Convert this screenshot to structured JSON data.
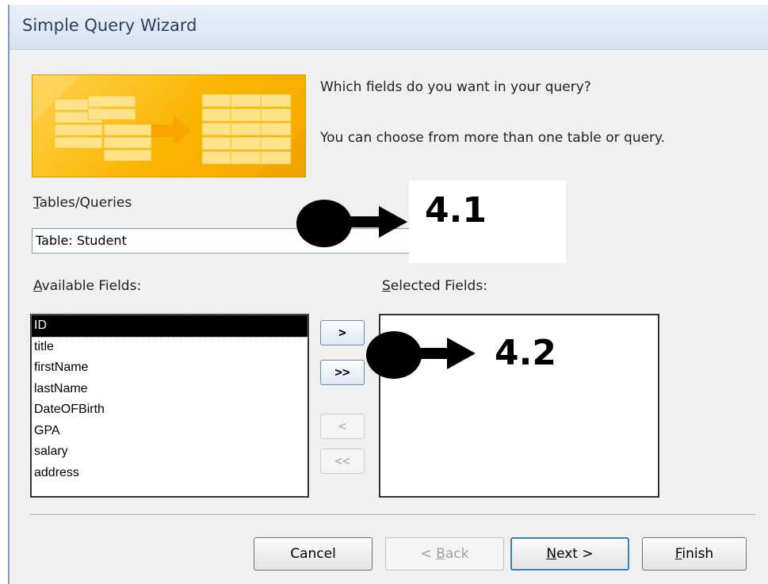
{
  "window": {
    "title": "Simple Query Wizard"
  },
  "intro": {
    "question": "Which fields do you want in your query?",
    "hint": "You can choose from more than one table or query."
  },
  "tables_queries": {
    "label_prefix": "T",
    "label_rest": "ables/Queries",
    "value": "Table: Student"
  },
  "available_fields": {
    "label_prefix": "A",
    "label_rest": "vailable Fields:",
    "items": [
      "ID",
      "title",
      "firstName",
      "lastName",
      "DateOFBirth",
      "GPA",
      "salary",
      "address"
    ],
    "selected_index": 0
  },
  "selected_fields": {
    "label_prefix": "S",
    "label_rest": "elected Fields:",
    "items": []
  },
  "move_buttons": {
    "add_one": ">",
    "add_all": ">>",
    "remove_one": "<",
    "remove_all": "<<"
  },
  "footer": {
    "cancel": "Cancel",
    "back_prefix": "< ",
    "back_key": "B",
    "back_rest": "ack",
    "next_key": "N",
    "next_rest": "ext >",
    "finish_key": "F",
    "finish_rest": "inish"
  },
  "annotations": {
    "callout1": "4.1",
    "callout2": "4.2"
  }
}
